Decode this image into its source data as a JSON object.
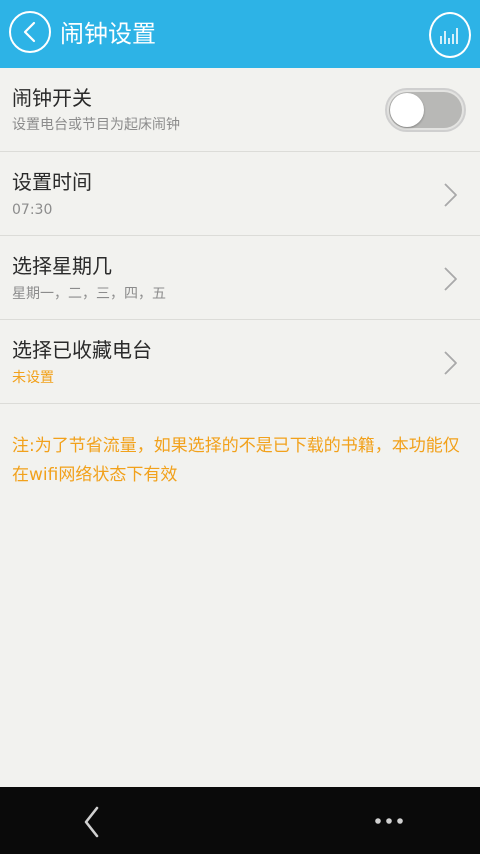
{
  "header": {
    "title": "闹钟设置",
    "accent": "#2db3e6"
  },
  "alarm_switch": {
    "title": "闹钟开关",
    "subtitle": "设置电台或节目为起床闹钟",
    "enabled": false
  },
  "set_time": {
    "title": "设置时间",
    "value": "07:30"
  },
  "weekdays": {
    "title": "选择星期几",
    "value": "星期一，二，三，四，五"
  },
  "station": {
    "title": "选择已收藏电台",
    "value": "未设置",
    "value_color": "#f2a11b"
  },
  "notice": "注:为了节省流量，如果选择的不是已下载的书籍，本功能仅在wifi网络状态下有效",
  "icons": {
    "back": "chevron-left-icon",
    "audio": "audio-bars-icon",
    "chevron": "chevron-right-icon",
    "nav_back": "nav-back-icon",
    "nav_more": "more-dots-icon"
  }
}
